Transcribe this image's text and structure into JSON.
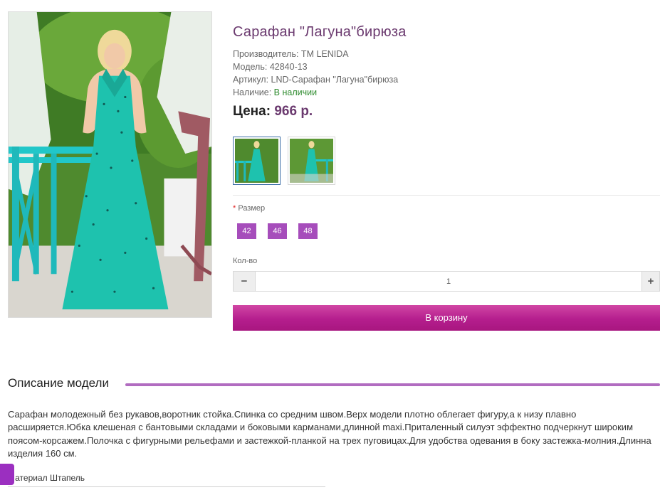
{
  "product": {
    "title": "Сарафан \"Лагуна\"бирюза",
    "manufacturer": "Производитель: TM LENIDA",
    "model": "Модель: 42840-13",
    "sku": "Артикул: LND-Сарафан \"Лагуна\"бирюза",
    "availability_label": "Наличие:",
    "availability_value": "В наличии",
    "price_label": "Цена:",
    "price_value": "966 р."
  },
  "sizes": {
    "label": "Размер",
    "required_mark": "*",
    "options": [
      "42",
      "46",
      "48"
    ]
  },
  "quantity": {
    "label": "Кол-во",
    "value": "1",
    "minus": "−",
    "plus": "+"
  },
  "cart": {
    "button_label": "В корзину"
  },
  "description": {
    "title": "Описание модели",
    "text": "Сарафан молодежный без рукавов,воротник стойка.Спинка со средним швом.Верх модели плотно облегает фигуру,а к низу плавно расширяется.Юбка клешеная с бантовыми складами и боковыми карманами,длинной maxi.Приталенный силуэт эффектно подчеркнут широким поясом-корсажем.Полочка с фигурными рельефами и застежкой-планкой на трех пуговицах.Для удобства одевания в боку застежка-молния.Длинна изделия 160 см.",
    "material": "Материал Штапель"
  },
  "colors": {
    "brand_purple": "#6b3a6f",
    "size_button": "#a64dbb",
    "cart_button": "#b51e8e",
    "in_stock": "#2e8b2e",
    "section_line": "#b16cc0"
  }
}
